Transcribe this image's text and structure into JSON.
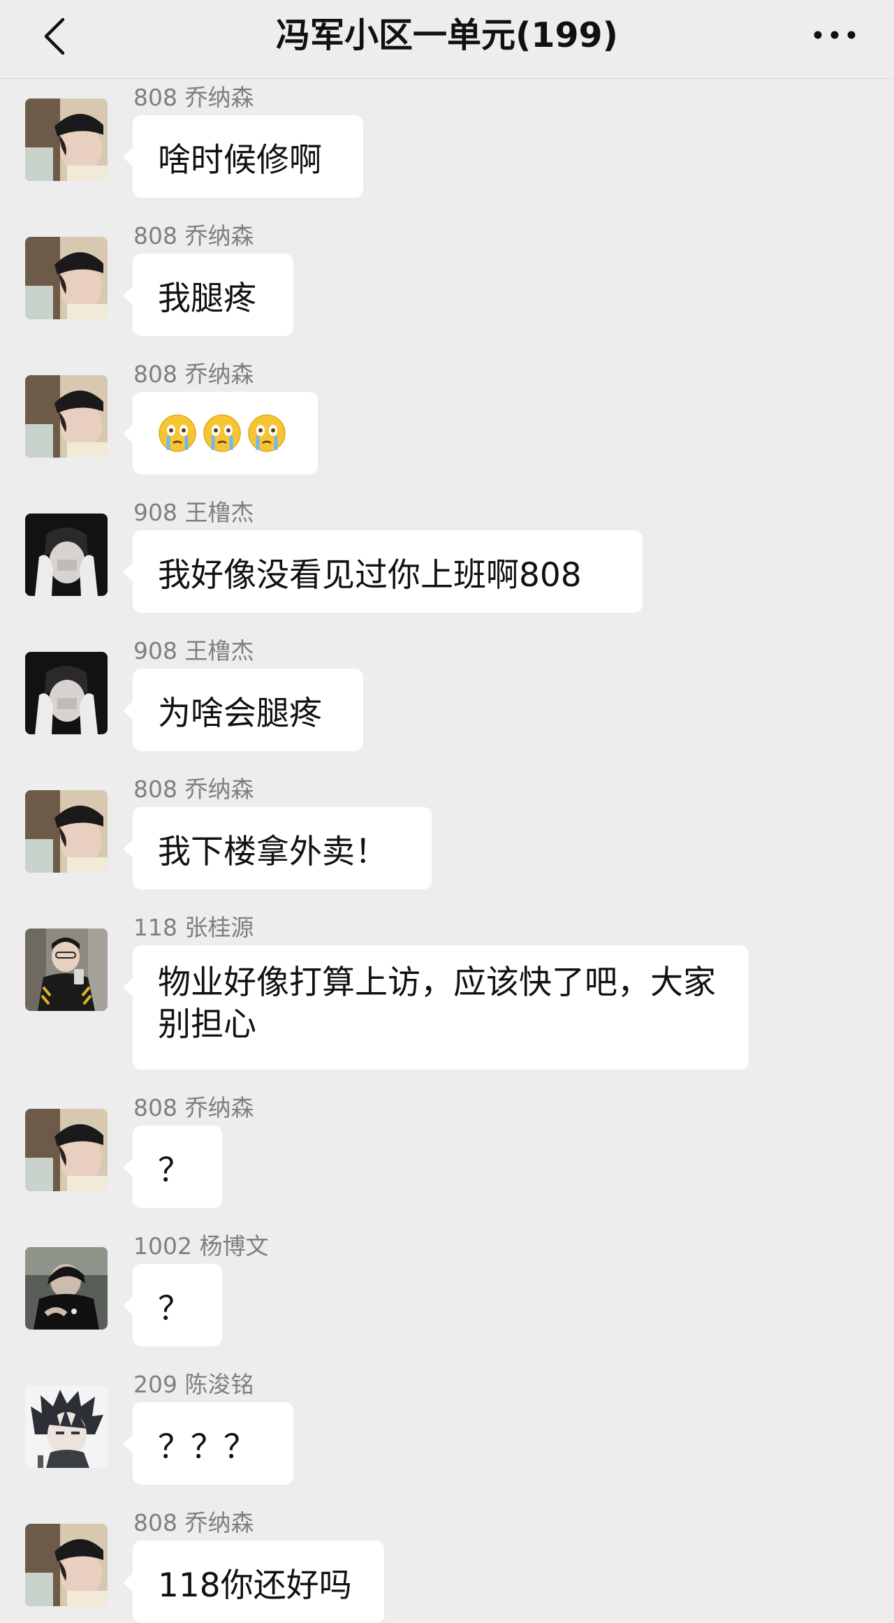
{
  "header": {
    "title": "冯军小区一单元(199)",
    "back_icon": "chevron-left-icon",
    "more_icon": "more-dots-icon"
  },
  "messages": [
    {
      "sender": "808 乔纳森",
      "text": "啥时候修啊",
      "avatar": "avatar-808"
    },
    {
      "sender": "808 乔纳森",
      "text": "我腿疼",
      "avatar": "avatar-808"
    },
    {
      "sender": "808 乔纳森",
      "text": "",
      "emoji": "crying-face-emoji",
      "emoji_count": 3,
      "avatar": "avatar-808"
    },
    {
      "sender": "908 王橹杰",
      "text": "我好像没看见过你上班啊808",
      "avatar": "avatar-908"
    },
    {
      "sender": "908 王橹杰",
      "text": "为啥会腿疼",
      "avatar": "avatar-908"
    },
    {
      "sender": "808 乔纳森",
      "text": "我下楼拿外卖！",
      "avatar": "avatar-808"
    },
    {
      "sender": "118 张桂源",
      "text": "物业好像打算上访，应该快了吧，大家别担心",
      "avatar": "avatar-118"
    },
    {
      "sender": "808 乔纳森",
      "text": "？",
      "avatar": "avatar-808"
    },
    {
      "sender": "1002 杨博文",
      "text": "？",
      "avatar": "avatar-1002"
    },
    {
      "sender": "209 陈浚铭",
      "text": "？？？",
      "avatar": "avatar-209"
    },
    {
      "sender": "808 乔纳森",
      "text": "118你还好吗",
      "avatar": "avatar-808"
    }
  ],
  "colors": {
    "background": "#ededed",
    "bubble": "#ffffff",
    "sender_name": "#7f7f7f",
    "text": "#111111"
  }
}
